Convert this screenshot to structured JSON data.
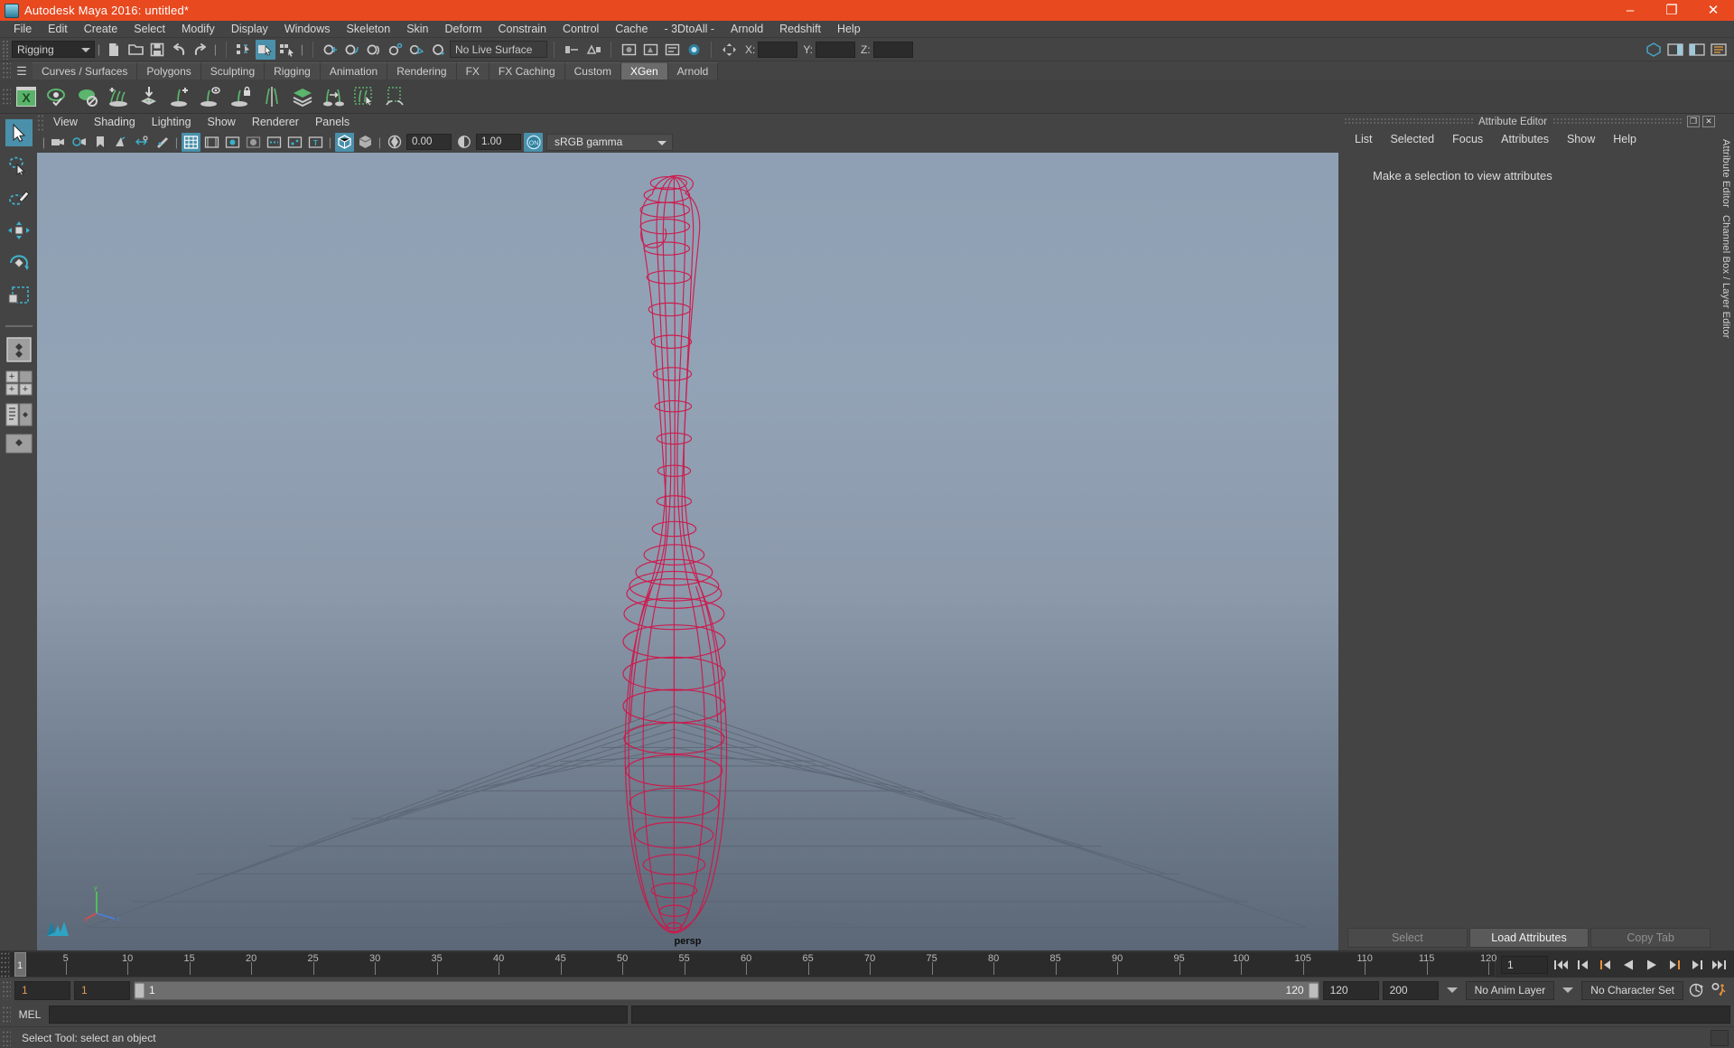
{
  "window": {
    "title": "Autodesk Maya 2016: untitled*",
    "icon": "maya-logo-icon",
    "minimize": "–",
    "maximize": "❐",
    "close": "✕"
  },
  "menubar": {
    "items": [
      "File",
      "Edit",
      "Create",
      "Select",
      "Modify",
      "Display",
      "Windows",
      "Skeleton",
      "Skin",
      "Deform",
      "Constrain",
      "Control",
      "Cache",
      "- 3DtoAll -",
      "Arnold",
      "Redshift",
      "Help"
    ]
  },
  "statusline": {
    "menuset": "Rigging",
    "live_surface": "No Live Surface",
    "coord_labels": [
      "X:",
      "Y:",
      "Z:"
    ],
    "coord_values": [
      "",
      "",
      ""
    ]
  },
  "shelf": {
    "tabs": [
      "Curves / Surfaces",
      "Polygons",
      "Sculpting",
      "Rigging",
      "Animation",
      "Rendering",
      "FX",
      "FX Caching",
      "Custom",
      "XGen",
      "Arnold"
    ],
    "active_tab": "XGen",
    "icons": [
      "xgen-editor-icon",
      "preview-toggle-icon",
      "preview-disable-icon",
      "add-description-icon",
      "import-collection-icon",
      "add-guide-icon",
      "guide-preview-icon",
      "lock-guide-icon",
      "mirror-guides-icon",
      "layers-icon",
      "transfer-guides-icon",
      "select-guides-icon",
      "clump-modifier-icon"
    ]
  },
  "viewport": {
    "menu": [
      "View",
      "Shading",
      "Lighting",
      "Show",
      "Renderer",
      "Panels"
    ],
    "exposure": "0.00",
    "gamma": "1.00",
    "color_space": "sRGB gamma",
    "camera_label": "persp",
    "gradient_top": "#8fa0b4",
    "gradient_bottom": "#5c6877",
    "mesh_color": "#d0164a",
    "axis_labels": [
      "x",
      "y",
      "z"
    ]
  },
  "attribute_editor": {
    "title": "Attribute Editor",
    "menu": [
      "List",
      "Selected",
      "Focus",
      "Attributes",
      "Show",
      "Help"
    ],
    "empty_message": "Make a selection to view attributes",
    "buttons": [
      {
        "label": "Select",
        "enabled": false
      },
      {
        "label": "Load Attributes",
        "enabled": true
      },
      {
        "label": "Copy Tab",
        "enabled": false
      }
    ],
    "side_tabs": [
      "Attribute Editor",
      "Channel Box / Layer Editor"
    ],
    "undock_glyph": "❐",
    "close_glyph": "✕"
  },
  "timeline": {
    "start": 1,
    "end": 120,
    "current_frame": "1",
    "tick_step": 5,
    "labels": [
      5,
      10,
      15,
      20,
      25,
      30,
      35,
      40,
      45,
      50,
      55,
      60,
      65,
      70,
      75,
      80,
      85,
      90,
      95,
      100,
      105,
      110,
      115,
      120
    ],
    "playback_buttons": [
      "go-to-start-icon",
      "step-back-frame-icon",
      "previous-key-icon",
      "play-backwards-icon",
      "play-forwards-icon",
      "next-key-icon",
      "step-forward-frame-icon",
      "go-to-end-icon"
    ]
  },
  "range_slider": {
    "anim_start": "1",
    "range_start": "1",
    "slider_start_label": "1",
    "slider_end_label": "120",
    "range_end": "120",
    "anim_end": "200",
    "anim_layer": "No Anim Layer",
    "character_set": "No Character Set",
    "auto_key_icon": "auto-key-icon",
    "prefs_icon": "animation-prefs-icon"
  },
  "command_line": {
    "label": "MEL",
    "value": "",
    "placeholder": ""
  },
  "status_bar": {
    "message": "Select Tool: select an object"
  },
  "toolbox": {
    "tools": [
      {
        "name": "select-tool",
        "active": true
      },
      {
        "name": "lasso-select-tool",
        "active": false
      },
      {
        "name": "paint-select-tool",
        "active": false
      },
      {
        "name": "move-tool",
        "active": false
      },
      {
        "name": "rotate-tool",
        "active": false
      },
      {
        "name": "scale-tool",
        "active": false
      }
    ],
    "layouts": [
      "single-pane-layout",
      "four-pane-layout",
      "outliner-persp-layout",
      "hypergraph-layout",
      "persp-graph-layout",
      "minimize-layout"
    ]
  }
}
